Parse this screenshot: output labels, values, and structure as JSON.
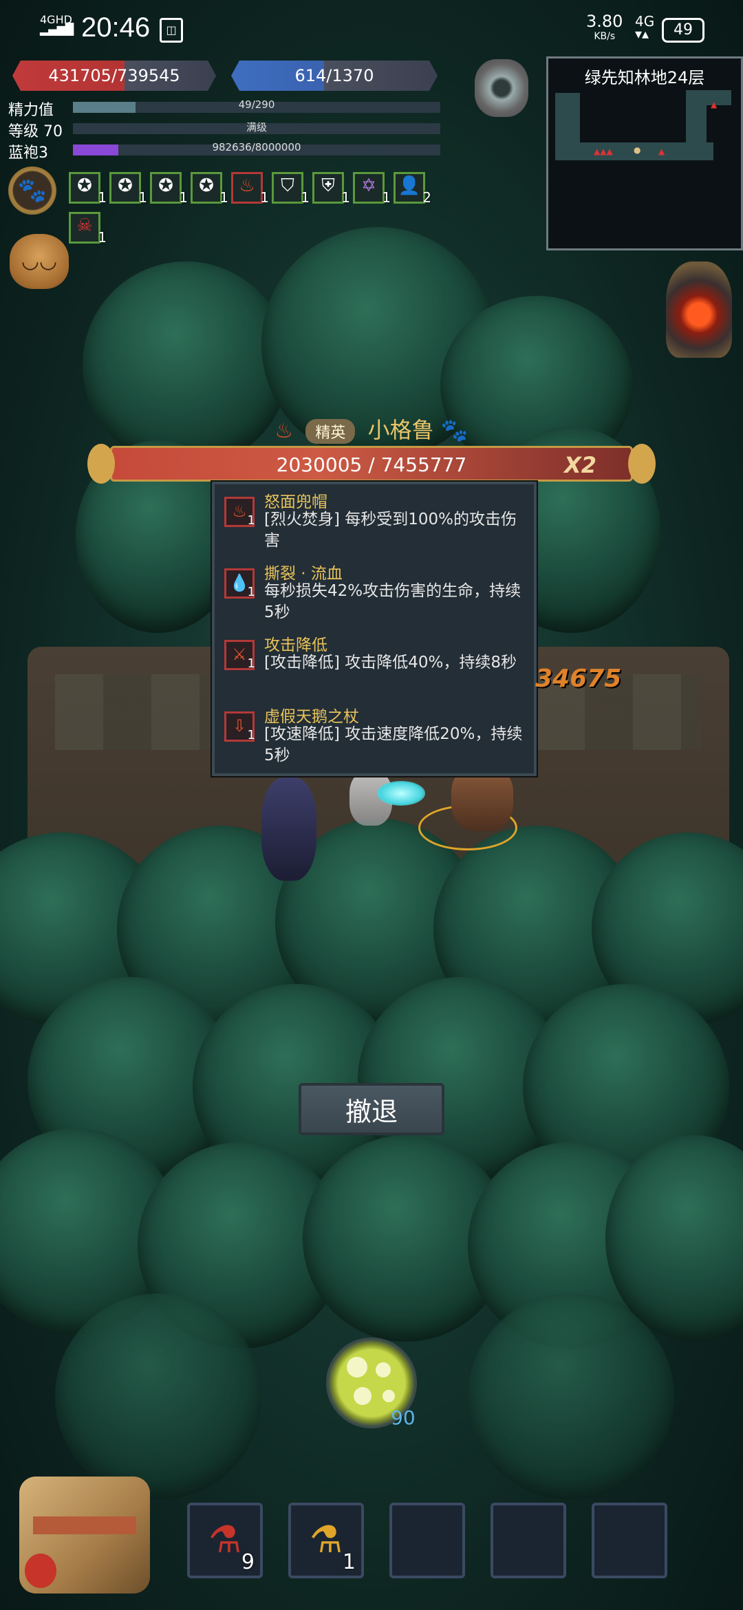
{
  "status_bar": {
    "time": "20:46",
    "network_type": "4GHD",
    "speed": "3.80",
    "speed_unit": "KB/s",
    "network": "4G",
    "battery": "49",
    "notification_icon": "calendar-icon"
  },
  "player": {
    "hp_text": "431705/739545",
    "hp_fraction": 0.584,
    "mp_text": "614/1370",
    "mp_fraction": 0.448
  },
  "stats": [
    {
      "label": "精力值",
      "value": "49/290",
      "fraction": 0.169,
      "color": "#5a7f8a"
    },
    {
      "label": "等级 70",
      "value": "满级",
      "fraction": 0.0,
      "color": "#5a7f8a"
    },
    {
      "label": "蓝袍3",
      "value": "982636/8000000",
      "fraction": 0.123,
      "color": "#8a48d6"
    }
  ],
  "minimap": {
    "title": "绿先知林地24层"
  },
  "buffs": [
    {
      "icon": "star-badge-icon",
      "count": "1"
    },
    {
      "icon": "star-badge-icon",
      "count": "1"
    },
    {
      "icon": "star-badge-icon",
      "count": "1"
    },
    {
      "icon": "star-badge-icon",
      "count": "1"
    },
    {
      "icon": "fire-icon",
      "count": "1"
    },
    {
      "icon": "shield-icon",
      "count": "1"
    },
    {
      "icon": "shield-arrow-icon",
      "count": "1"
    },
    {
      "icon": "pentagram-icon",
      "count": "1"
    },
    {
      "icon": "ghost-icon",
      "count": "2"
    },
    {
      "icon": "blood-skull-icon",
      "count": "1"
    }
  ],
  "boss": {
    "tag": "精英",
    "name": "小格鲁",
    "hp_text": "2030005 / 7455777",
    "hp_fraction": 0.272,
    "multiplier": "X2"
  },
  "debuffs": [
    {
      "icon": "fire-icon",
      "count": "1",
      "title": "怒面兜帽",
      "desc": "[烈火焚身] 每秒受到100%的攻击伤害"
    },
    {
      "icon": "blood-drop-icon",
      "count": "1",
      "title": "撕裂 · 流血",
      "desc": "每秒损失42%攻击伤害的生命，持续5秒"
    },
    {
      "icon": "attack-down-icon",
      "count": "1",
      "title": "攻击降低",
      "desc": "[攻击降低] 攻击降低40%，持续8秒"
    },
    {
      "icon": "speed-down-icon",
      "count": "1",
      "title": "虚假天鹅之杖",
      "desc": "[攻速降低] 攻击速度降低20%，持续5秒"
    }
  ],
  "damage_number": "34675",
  "retreat_label": "撤退",
  "skill": {
    "icon": "spore-skill-icon",
    "count": "90"
  },
  "inventory": [
    {
      "icon": "red-potion-icon",
      "count": "9"
    },
    {
      "icon": "blue-potion-icon",
      "count": "1"
    },
    {
      "icon": "",
      "count": ""
    },
    {
      "icon": "",
      "count": ""
    },
    {
      "icon": "",
      "count": ""
    }
  ]
}
